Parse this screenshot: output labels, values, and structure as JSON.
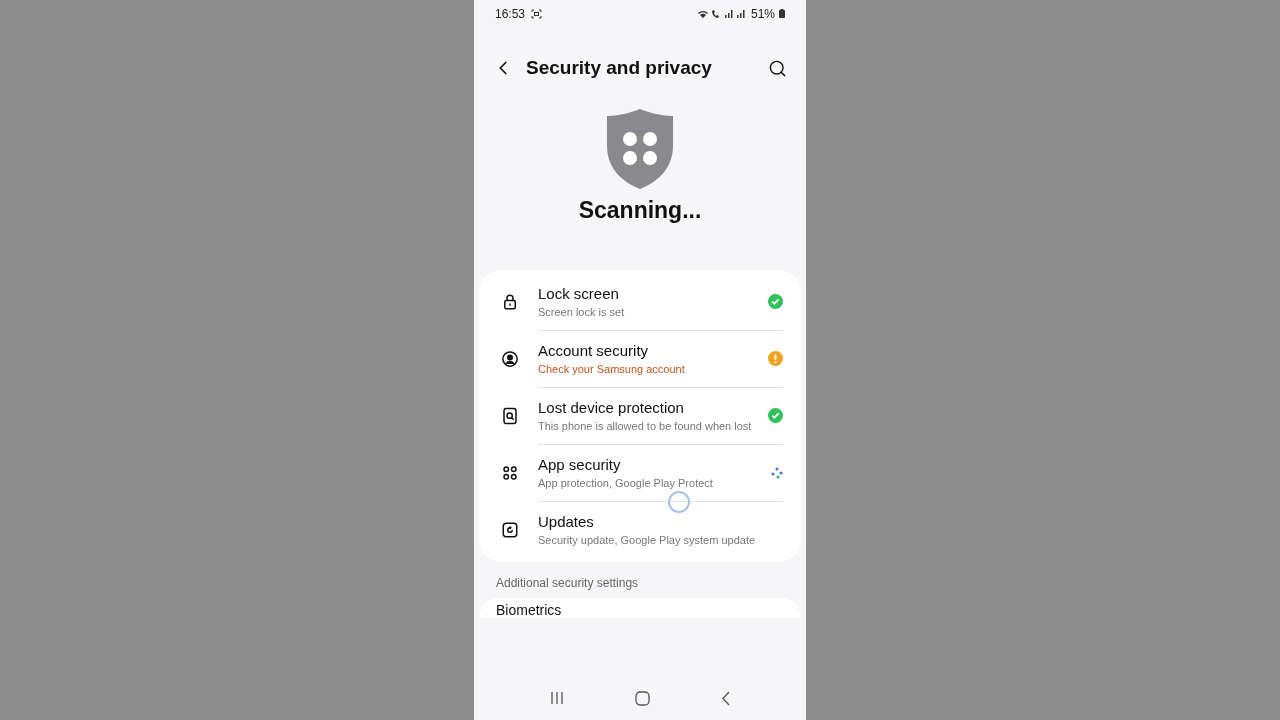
{
  "status_bar": {
    "time": "16:53",
    "battery": "51%"
  },
  "header": {
    "title": "Security and privacy"
  },
  "scan": {
    "text": "Scanning..."
  },
  "items": [
    {
      "kind": "ok",
      "title": "Lock screen",
      "subtitle": "Screen lock is set"
    },
    {
      "kind": "warning",
      "title": "Account security",
      "subtitle": "Check your Samsung account"
    },
    {
      "kind": "ok",
      "title": "Lost device protection",
      "subtitle": "This phone is allowed to be found when lost"
    },
    {
      "kind": "scanning",
      "title": "App security",
      "subtitle": "App protection, Google Play Protect"
    },
    {
      "kind": "plain",
      "title": "Updates",
      "subtitle": "Security update, Google Play system update"
    }
  ],
  "section": {
    "title": "Additional security settings"
  },
  "more_items": [
    {
      "title": "Biometrics"
    }
  ]
}
